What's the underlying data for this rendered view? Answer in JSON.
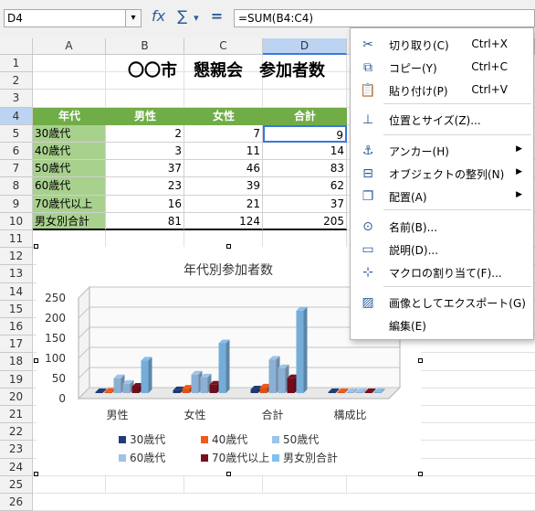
{
  "namebox": {
    "value": "D4",
    "dropdown_glyph": "▾"
  },
  "toolbar_icons": [
    {
      "name": "function-wizard-icon",
      "glyph": "fx"
    },
    {
      "name": "sum-icon",
      "glyph": "∑"
    },
    {
      "name": "sum-dropdown-icon",
      "glyph": "▾"
    },
    {
      "name": "formula-icon",
      "glyph": "="
    }
  ],
  "formula": {
    "value": "=SUM(B4:C4)"
  },
  "columns": [
    "A",
    "B",
    "C",
    "D"
  ],
  "rows": [
    "1",
    "2",
    "3",
    "4",
    "5",
    "6",
    "7",
    "8",
    "9",
    "10",
    "11",
    "12",
    "13",
    "14",
    "15",
    "16",
    "17",
    "18",
    "19",
    "20",
    "21",
    "22",
    "23",
    "24",
    "25",
    "26"
  ],
  "sheet_title": "〇〇市　懇親会　参加者数",
  "table_headers": [
    "年代",
    "男性",
    "女性",
    "合計"
  ],
  "table_rows": [
    [
      "30歳代",
      "2",
      "7",
      "9"
    ],
    [
      "40歳代",
      "3",
      "11",
      "14"
    ],
    [
      "50歳代",
      "37",
      "46",
      "83"
    ],
    [
      "60歳代",
      "23",
      "39",
      "62"
    ],
    [
      "70歳代以上",
      "16",
      "21",
      "37"
    ],
    [
      "男女別合計",
      "81",
      "124",
      "205"
    ]
  ],
  "chart_data": {
    "type": "bar",
    "title": "年代別参加者数",
    "categories": [
      "男性",
      "女性",
      "合計",
      "構成比"
    ],
    "ylim": [
      0,
      250
    ],
    "yticks": [
      "0",
      "50",
      "100",
      "150",
      "200",
      "250"
    ],
    "series": [
      {
        "name": "30歳代",
        "color": "#1f3d7a",
        "values": [
          2,
          7,
          9,
          0
        ]
      },
      {
        "name": "40歳代",
        "color": "#f05a1a",
        "values": [
          3,
          11,
          14,
          0
        ]
      },
      {
        "name": "50歳代",
        "color": "#9cc3ea",
        "values": [
          37,
          46,
          83,
          0
        ]
      },
      {
        "name": "60歳代",
        "color": "#9cc3ea",
        "values": [
          23,
          39,
          62,
          0
        ]
      },
      {
        "name": "70歳代以上",
        "color": "#7a0f1f",
        "values": [
          16,
          21,
          37,
          0
        ]
      },
      {
        "name": "男女別合計",
        "color": "#82c0f0",
        "values": [
          81,
          124,
          205,
          0
        ]
      }
    ],
    "legend_position": "bottom"
  },
  "context_menu": {
    "items": [
      {
        "icon": "cut-icon",
        "glyph": "✂",
        "label": "切り取り(C)",
        "shortcut": "Ctrl+X",
        "submenu": false
      },
      {
        "icon": "copy-icon",
        "glyph": "⧉",
        "label": "コピー(Y)",
        "shortcut": "Ctrl+C",
        "submenu": false
      },
      {
        "icon": "paste-icon",
        "glyph": "📋",
        "label": "貼り付け(P)",
        "shortcut": "Ctrl+V",
        "submenu": false
      },
      {
        "icon": "position-size-icon",
        "glyph": "⊥",
        "label": "位置とサイズ(Z)...",
        "shortcut": "",
        "submenu": false
      },
      {
        "icon": "anchor-icon",
        "glyph": "⚓",
        "label": "アンカー(H)",
        "shortcut": "",
        "submenu": true
      },
      {
        "icon": "align-objects-icon",
        "glyph": "⊟",
        "label": "オブジェクトの整列(N)",
        "shortcut": "",
        "submenu": true
      },
      {
        "icon": "arrange-icon",
        "glyph": "❐",
        "label": "配置(A)",
        "shortcut": "",
        "submenu": true
      },
      {
        "icon": "name-icon",
        "glyph": "⊙",
        "label": "名前(B)...",
        "shortcut": "",
        "submenu": false
      },
      {
        "icon": "description-icon",
        "glyph": "▭",
        "label": "説明(D)...",
        "shortcut": "",
        "submenu": false
      },
      {
        "icon": "assign-macro-icon",
        "glyph": "⊹",
        "label": "マクロの割り当て(F)...",
        "shortcut": "",
        "submenu": false
      },
      {
        "icon": "export-image-icon",
        "glyph": "▨",
        "label": "画像としてエクスポート(G)",
        "shortcut": "",
        "submenu": false
      },
      {
        "icon": "edit-icon",
        "glyph": "",
        "label": "編集(E)",
        "shortcut": "",
        "submenu": false
      }
    ]
  }
}
